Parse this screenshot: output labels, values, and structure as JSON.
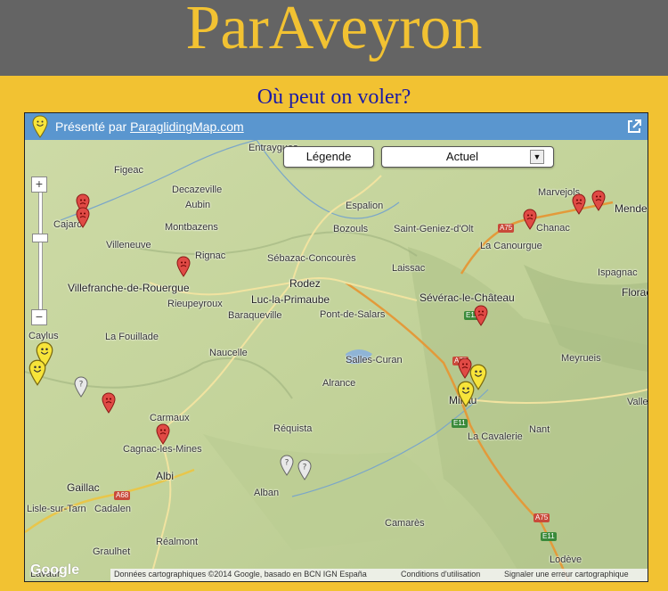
{
  "header": {
    "title": "ParAveyron"
  },
  "subtitle": "Où peut on voler?",
  "map": {
    "credit_prefix": "Présenté par ",
    "credit_link": "ParaglidingMap.com",
    "legend_button": "Légende",
    "mode_select": "Actuel",
    "google_logo": "Google",
    "footer": {
      "data_credit": "Données cartographiques ©2014 Google, basado en BCN IGN España",
      "terms": "Conditions d'utilisation",
      "report": "Signaler une erreur cartographique"
    },
    "places": {
      "figeac": "Figeac",
      "decazeville": "Decazeville",
      "aubin": "Aubin",
      "cajarc": "Cajarc",
      "villeneuve": "Villeneuve",
      "montbazens": "Montbazens",
      "rignac": "Rignac",
      "villefranche": "Villefranche-de-Rouergue",
      "rieupeyroux": "Rieupeyroux",
      "baraqueville": "Baraqueville",
      "caylus": "Caylus",
      "fouillade": "La Fouillade",
      "naucelle": "Naucelle",
      "carmaux": "Carmaux",
      "cagnac": "Cagnac-les-Mines",
      "albi": "Albi",
      "gaillac": "Gaillac",
      "lisle": "Lisle-sur-Tarn",
      "cadalen": "Cadalen",
      "graulhet": "Graulhet",
      "realmont": "Réalmont",
      "lavaur": "Lavaur",
      "entraygues": "Entraygues",
      "espalion": "Espalion",
      "bozouls": "Bozouls",
      "sebazac": "Sébazac-Concourès",
      "rodez": "Rodez",
      "luc": "Luc-la-Primaube",
      "pont_salars": "Pont-de-Salars",
      "laissac": "Laissac",
      "salles_curan": "Salles-Curan",
      "alrance": "Alrance",
      "requista": "Réquista",
      "alban": "Alban",
      "camares": "Camarès",
      "marvejols": "Marvejols",
      "mende": "Mende",
      "chanac": "Chanac",
      "st_geniez": "Saint-Geniez-d'Olt",
      "canourgue": "La Canourgue",
      "severac": "Sévérac-le-Château",
      "ispagnac": "Ispagnac",
      "florac": "Florac",
      "meyrueis": "Meyrueis",
      "millau": "Millau",
      "cavalerie": "La Cavalerie",
      "nant": "Nant",
      "valleraugue": "Valle",
      "lodeve": "Lodève"
    },
    "roads": {
      "a75": "A75",
      "e11": "E11",
      "a68": "A68"
    }
  },
  "colors": {
    "accent": "#f2c232",
    "header_bg": "#646464",
    "subtitle": "#1a1aa6",
    "map_bar": "#5a96cf",
    "marker_red": "#e04a45",
    "marker_yellow": "#f7e43a",
    "marker_grey": "#e8e8e8"
  },
  "icons": {
    "brand": "smiley-pin-icon",
    "external": "external-link-icon",
    "marker_red": "frown-marker-icon",
    "marker_yellow": "smile-marker-icon",
    "marker_grey": "question-marker-icon"
  }
}
